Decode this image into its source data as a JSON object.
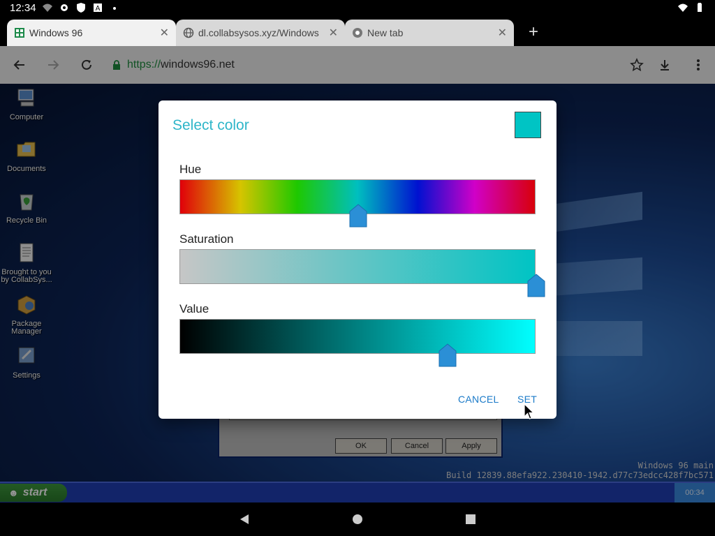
{
  "status_bar": {
    "time": "12:34"
  },
  "browser": {
    "tabs": [
      {
        "label": "Windows 96",
        "active": true
      },
      {
        "label": "dl.collabsysos.xyz/Windows",
        "active": false
      },
      {
        "label": "New tab",
        "active": false
      }
    ],
    "url_scheme": "https://",
    "url_host": "windows96.net"
  },
  "desktop": {
    "icons": [
      {
        "label": "Computer"
      },
      {
        "label": "Documents"
      },
      {
        "label": "Recycle Bin"
      },
      {
        "label": "Brought to you by CollabSys..."
      },
      {
        "label": "Package Manager"
      },
      {
        "label": "Settings"
      }
    ],
    "background_window": {
      "ok_label": "OK",
      "cancel_label": "Cancel",
      "apply_label": "Apply"
    },
    "build_line1": "Windows 96 main",
    "build_line2": "Build 12839.88efa922.230410-1942.d77c73edcc428f7bc571"
  },
  "taskbar": {
    "start_label": "start",
    "clock": "00:34"
  },
  "dialog": {
    "title": "Select color",
    "preview_color": "#00c4c4",
    "hue_label": "Hue",
    "saturation_label": "Saturation",
    "value_label": "Value",
    "hue": 0.5,
    "saturation": 1.0,
    "value": 0.75,
    "cancel_label": "CANCEL",
    "set_label": "SET"
  },
  "colors": {
    "accent": "#2fb6c9",
    "button_text": "#1a7ac8",
    "thumb": "#2b8fd6"
  }
}
